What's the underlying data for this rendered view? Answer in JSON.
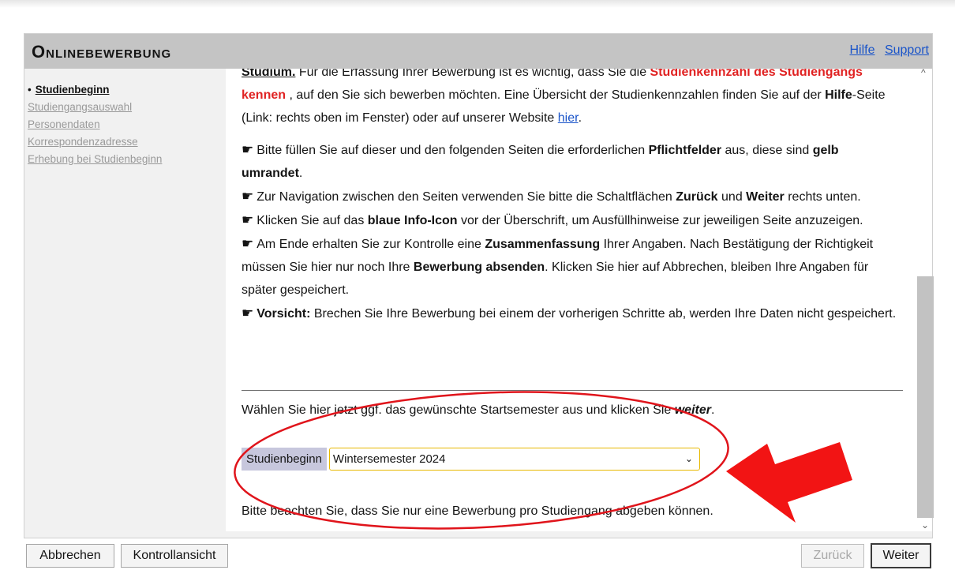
{
  "header": {
    "title": "Onlinebewerbung",
    "help_link": "Hilfe",
    "support_link": "Support"
  },
  "nav": {
    "items": [
      {
        "label": "Studienbeginn",
        "active": true
      },
      {
        "label": "Studiengangsauswahl",
        "active": false
      },
      {
        "label": "Personendaten",
        "active": false
      },
      {
        "label": "Korrespondenzadresse",
        "active": false
      },
      {
        "label": "Erhebung bei Studienbeginn",
        "active": false
      }
    ]
  },
  "content": {
    "p1_a": "Studium.",
    "p1_b": " Für die Erfassung Ihrer Bewerbung ist es wichtig, dass Sie die ",
    "p1_c": "Studienkennzahl des Studiengangs kennen",
    "p1_d": " , auf den Sie sich bewerben möchten. Eine Übersicht der Studienkennzahlen finden Sie auf der ",
    "p1_e": "Hilfe",
    "p1_f": "-Seite (Link: rechts oben im Fenster) oder auf unserer Website ",
    "p1_link": "hier",
    "p1_g": ".",
    "b1_a": "Bitte füllen Sie auf dieser und den folgenden Seiten die erforderlichen ",
    "b1_b": "Pflichtfelder",
    "b1_c": " aus, diese sind ",
    "b1_d": "gelb umrandet",
    "b1_e": ".",
    "b2_a": "Zur Navigation zwischen den Seiten verwenden Sie bitte die Schaltflächen ",
    "b2_b": "Zurück",
    "b2_c": " und ",
    "b2_d": "Weiter",
    "b2_e": " rechts unten.",
    "b3_a": "Klicken Sie auf das ",
    "b3_b": "blaue Info-Icon",
    "b3_c": " vor der Überschrift, um Ausfüllhinweise zur jeweiligen Seite anzuzeigen.",
    "b4_a": "Am Ende erhalten Sie zur Kontrolle eine ",
    "b4_b": "Zusammenfassung",
    "b4_c": " Ihrer Angaben. Nach Bestätigung der Richtigkeit müssen Sie hier nur noch Ihre ",
    "b4_d": "Bewerbung absenden",
    "b4_e": ". Klicken Sie hier auf Abbrechen, bleiben Ihre Angaben für später gespeichert.",
    "b5_a": "Vorsicht:",
    "b5_b": " Brechen Sie Ihre Bewerbung bei einem der vorherigen Schritte ab, werden Ihre Daten nicht gespeichert.",
    "choose_a": "Wählen Sie hier jetzt ggf. das gewünschte Startsemester aus und klicken Sie ",
    "choose_b": "weiter",
    "choose_c": ".",
    "field_label": "Studienbeginn",
    "field_value": "Wintersemester 2024",
    "note": "Bitte beachten Sie, dass Sie nur eine Bewerbung pro Studiengang abgeben können."
  },
  "buttons": {
    "cancel": "Abbrechen",
    "review": "Kontrollansicht",
    "back": "Zurück",
    "next": "Weiter"
  },
  "icons": {
    "bullet": "☛",
    "chevron_down": "⌄",
    "scroll_up": "^",
    "scroll_down": "⌄"
  },
  "colors": {
    "annotation_red": "#e0141b",
    "header_bg": "#c4c4c4",
    "link_blue": "#1a54c9",
    "required_yellow": "#e8b800"
  }
}
